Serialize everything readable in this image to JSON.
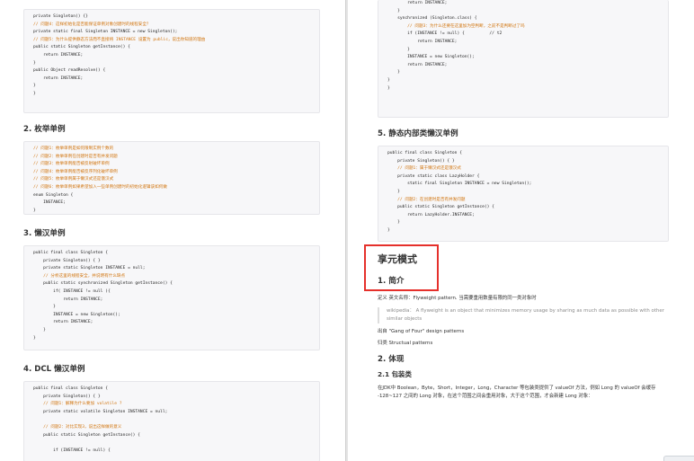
{
  "left": {
    "block1": [
      {
        "text": "private Singleton() {}",
        "comment": false
      },
      {
        "text": "// 问题4：这样初始化是否能保证单例对象创建时的线程安全？",
        "comment": true
      },
      {
        "text": "private static final Singleton INSTANCE = new Singleton();",
        "comment": false
      },
      {
        "text": "// 问题5：为什么提供静态方法而不直接将 INSTANCE 设置为 public，说出你知道的理由",
        "comment": true
      },
      {
        "text": "public static Singleton getInstance() {",
        "comment": false
      },
      {
        "text": "    return INSTANCE;",
        "comment": false
      },
      {
        "text": "}",
        "comment": false
      },
      {
        "text": "public Object readResolve() {",
        "comment": false
      },
      {
        "text": "    return INSTANCE;",
        "comment": false
      },
      {
        "text": "}",
        "comment": false
      },
      {
        "text": "}",
        "comment": false
      }
    ],
    "h_enum": "2. 枚举单例",
    "block_enum": [
      {
        "text": "// 问题1：枚举单例是如何限制实例个数的",
        "comment": true
      },
      {
        "text": "// 问题2：枚举单例在创建时是否有并发问题",
        "comment": true
      },
      {
        "text": "// 问题3：枚举单例能否被反射破坏单例",
        "comment": true
      },
      {
        "text": "// 问题4：枚举单例能否被反序列化破坏单例",
        "comment": true
      },
      {
        "text": "// 问题5：枚举单例属于懒汉式还是饿汉式",
        "comment": true
      },
      {
        "text": "// 问题6：枚举单例如果希望加入一些单例创建时的初始化逻辑该如何做",
        "comment": true
      },
      {
        "text": "enum Singleton {",
        "comment": false
      },
      {
        "text": "    INSTANCE;",
        "comment": false
      },
      {
        "text": "}",
        "comment": false
      }
    ],
    "h_lazy": "3. 懒汉单例",
    "block_lazy": [
      {
        "text": "public final class Singleton {",
        "comment": false
      },
      {
        "text": "    private Singleton() { }",
        "comment": false
      },
      {
        "text": "    private static Singleton INSTANCE = null;",
        "comment": false
      },
      {
        "text": "    // 分析这里的线程安全，并说明有什么缺点",
        "comment": true
      },
      {
        "text": "    public static synchronized Singleton getInstance() {",
        "comment": false
      },
      {
        "text": "        if( INSTANCE != null ){",
        "comment": false
      },
      {
        "text": "            return INSTANCE;",
        "comment": false
      },
      {
        "text": "        }",
        "comment": false
      },
      {
        "text": "        INSTANCE = new Singleton();",
        "comment": false
      },
      {
        "text": "        return INSTANCE;",
        "comment": false
      },
      {
        "text": "    }",
        "comment": false
      },
      {
        "text": "}",
        "comment": false
      }
    ],
    "h_dcl": "4. DCL 懒汉单例",
    "block_dcl": [
      {
        "text": "public final class Singleton {",
        "comment": false
      },
      {
        "text": "    private Singleton() { }",
        "comment": false
      },
      {
        "text": "    // 问题1：解释为什么要加 volatile ?",
        "comment": true
      },
      {
        "text": "    private static volatile Singleton INSTANCE = null;",
        "comment": false
      },
      {
        "text": "",
        "comment": false
      },
      {
        "text": "    // 问题2：对比实现3，说出这样做的意义",
        "comment": true
      },
      {
        "text": "    public static Singleton getInstance() {",
        "comment": false
      },
      {
        "text": "",
        "comment": false
      },
      {
        "text": "        if (INSTANCE != null) {",
        "comment": false
      }
    ]
  },
  "right": {
    "block_cont": [
      {
        "text": "        return INSTANCE;",
        "comment": false
      },
      {
        "text": "    }",
        "comment": false
      },
      {
        "text": "    synchronized (Singleton.class) {",
        "comment": false
      },
      {
        "text": "        // 问题3：为什么还要在这里加为空判断，之前不是判断过了吗",
        "comment": true
      },
      {
        "text": "        if (INSTANCE != null) {          // t2",
        "comment": false
      },
      {
        "text": "            return INSTANCE;",
        "comment": false
      },
      {
        "text": "        }",
        "comment": false
      },
      {
        "text": "        INSTANCE = new Singleton();",
        "comment": false
      },
      {
        "text": "        return INSTANCE;",
        "comment": false
      },
      {
        "text": "    }",
        "comment": false
      },
      {
        "text": "}",
        "comment": false
      },
      {
        "text": "}",
        "comment": false
      }
    ],
    "h_static": "5. 静态内部类懒汉单例",
    "block_static": [
      {
        "text": "public final class Singleton {",
        "comment": false
      },
      {
        "text": "    private Singleton() { }",
        "comment": false
      },
      {
        "text": "    // 问题1：属于懒汉式还是饿汉式",
        "comment": true
      },
      {
        "text": "    private static class LazyHolder {",
        "comment": false
      },
      {
        "text": "        static final Singleton INSTANCE = new Singleton();",
        "comment": false
      },
      {
        "text": "    }",
        "comment": false
      },
      {
        "text": "    // 问题2：在创建时是否有并发问题",
        "comment": true
      },
      {
        "text": "    public static Singleton getInstance() {",
        "comment": false
      },
      {
        "text": "        return LazyHolder.INSTANCE;",
        "comment": false
      },
      {
        "text": "    }",
        "comment": false
      },
      {
        "text": "}",
        "comment": false
      }
    ],
    "h_flyweight": "享元模式",
    "h_intro": "1. 简介",
    "p_def": "定义 英文名称：Flyweight pattern. 当需要重用数量有限的同一类对象时",
    "quote": "wikipedia： A flyweight is an object that minimizes memory usage by sharing as much data as possible with other similar objects",
    "p_source": "出自 \"Gang of Four\" design patterns",
    "p_category": "归类 Structual patterns",
    "h_embody": "2. 体现",
    "h_wrapper": "2.1 包装类",
    "p_wrapper": "在JDK中 Boolean，Byte，Short，Integer，Long，Character 等包装类提供了 valueOf 方法，例如 Long 的 valueOf 会缓存 -128~127 之间的 Long 对象，在这个范围之间会重用对象，大于这个范围，才会新建 Long 对象："
  }
}
